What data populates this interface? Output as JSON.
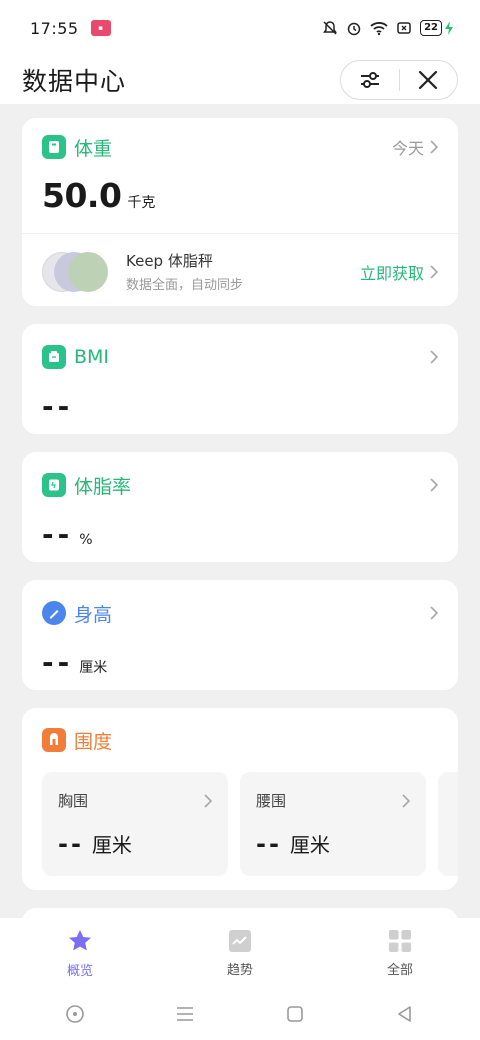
{
  "status": {
    "time": "17:55",
    "battery": "22"
  },
  "header": {
    "title": "数据中心"
  },
  "weight": {
    "title": "体重",
    "date": "今天",
    "value": "50.0",
    "unit": "千克",
    "color": "#26b879"
  },
  "keep": {
    "title": "Keep 体脂秤",
    "subtitle": "数据全面，自动同步",
    "cta": "立即获取"
  },
  "bmi": {
    "title": "BMI",
    "value": "--"
  },
  "body_fat": {
    "title": "体脂率",
    "value": "--",
    "unit": "%"
  },
  "height": {
    "title": "身高",
    "value": "--",
    "unit": "厘米",
    "color": "#4a86ec"
  },
  "girth": {
    "title": "围度",
    "color": "#f07e3a",
    "items": [
      {
        "label": "胸围",
        "value": "--",
        "unit": "厘米"
      },
      {
        "label": "腰围",
        "value": "--",
        "unit": "厘米"
      }
    ]
  },
  "nav": {
    "items": [
      {
        "label": "概览",
        "icon": "star-icon",
        "active": true
      },
      {
        "label": "趋势",
        "icon": "trend-icon",
        "active": false
      },
      {
        "label": "全部",
        "icon": "grid-icon",
        "active": false
      }
    ],
    "active_color": "#7a6ff0"
  }
}
